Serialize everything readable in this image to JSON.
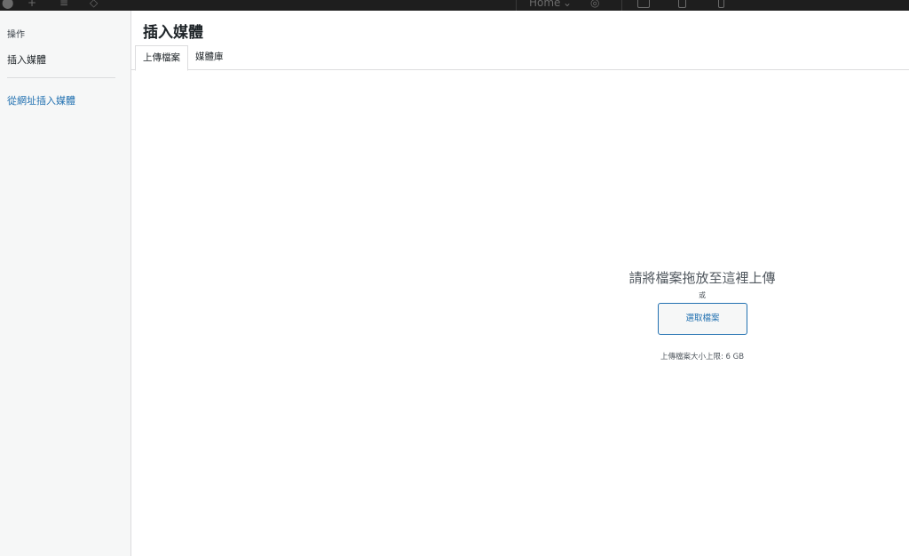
{
  "toolbar": {
    "page_select": "Home",
    "page_select_icon": "chevron-down-icon",
    "icons": [
      "wordpress-logo-icon",
      "plus-icon",
      "list-view-icon",
      "layers-icon",
      "eye-icon",
      "desktop-icon",
      "tablet-icon",
      "mobile-icon"
    ]
  },
  "sidebar": {
    "heading": "操作",
    "current_item": "插入媒體",
    "link_item": "從網址插入媒體"
  },
  "main": {
    "title": "插入媒體",
    "tabs": [
      {
        "label": "上傳檔案",
        "active": true
      },
      {
        "label": "媒體庫",
        "active": false
      }
    ],
    "upload": {
      "drop_text": "請將檔案拖放至這裡上傳",
      "or_text": "或",
      "select_button": "選取檔案",
      "max_size": "上傳檔案大小上限: 6 GB"
    }
  },
  "colors": {
    "accent": "#2271b1",
    "sidebar_bg": "#f6f7f7",
    "border": "#dcdcde",
    "toolbar_bg": "#1e1e1e"
  }
}
